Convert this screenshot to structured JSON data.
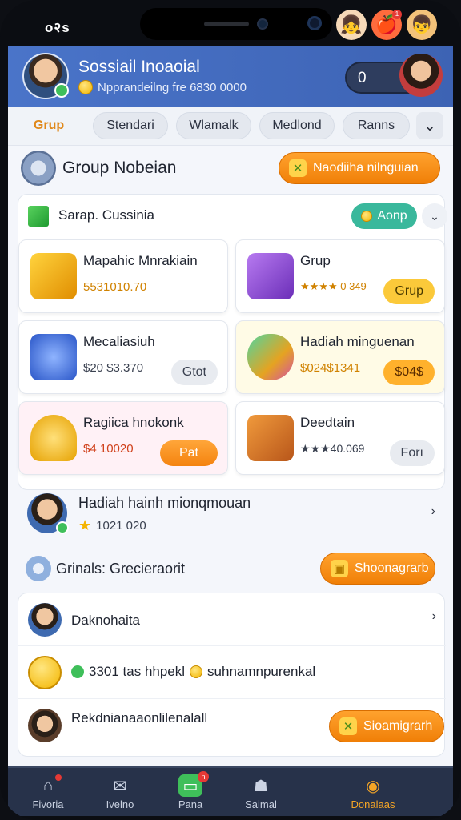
{
  "status": {
    "carrier": "o२s"
  },
  "header": {
    "title": "Sossiail Inoaoial",
    "subtitle": "Npprandeilng fre 6830 0000",
    "toggle_value": "0"
  },
  "tabs": [
    {
      "label": "Grup",
      "active": true
    },
    {
      "label": "Stendari",
      "active": false
    },
    {
      "label": "Wlamalk",
      "active": false
    },
    {
      "label": "Medlond",
      "active": false
    },
    {
      "label": "Ranns",
      "active": false
    }
  ],
  "group_section": {
    "title": "Group Nobeian",
    "action_label": "Naodiiha nilnguian"
  },
  "group_panel": {
    "title": "Sarap. Cussinia",
    "pill_label": "Aonp",
    "cards": [
      {
        "title": "Mapahic Mnrakiain",
        "price": "5531010.70",
        "button": null,
        "icon": "treasure-chest-icon",
        "tint": "#ffffff"
      },
      {
        "title": "Grup",
        "price": "★★★★ 0 349",
        "button": "Grup",
        "icon": "purple-chest-icon",
        "tint": "#ffffff"
      },
      {
        "title": "Mecaliasiuh",
        "price": "$20 $3.370",
        "button": "Gtot",
        "icon": "robot-toy-icon",
        "tint": "#ffffff"
      },
      {
        "title": "Hadiah minguenan",
        "price": "$024$1341",
        "button": "$04$",
        "icon": "gem-shield-icon",
        "tint": "#fffbe6"
      },
      {
        "title": "Ragiica hnokonk",
        "price": "$4 10020",
        "button": "Pat",
        "icon": "golden-vase-icon",
        "tint": "#fff1f6"
      },
      {
        "title": "Deedtain",
        "price": "★★★40.069",
        "button": "Forı",
        "icon": "wooden-box-icon",
        "tint": "#ffffff"
      }
    ]
  },
  "featured_person": {
    "name": "Hadiah hainh mionqmouan",
    "value": "1021 020"
  },
  "social_section": {
    "title": "Grinals: Grecieraorit",
    "action_label": "Shoonagrarb"
  },
  "list": [
    {
      "title": "Daknohaita",
      "extra": "",
      "has_chevron": true,
      "action": null
    },
    {
      "title": "3301 tas hhpekl",
      "extra": "suhnamnpurenkal",
      "has_chevron": false,
      "action": null
    },
    {
      "title": "Rekdnianaaonlilenalall",
      "extra": "",
      "has_chevron": false,
      "action": "Sioamigrarh"
    }
  ],
  "bottom_nav": [
    {
      "label": "Fivoria",
      "icon": "home-icon",
      "badge": "",
      "active": false
    },
    {
      "label": "Ivelno",
      "icon": "mail-icon",
      "badge": "",
      "active": false
    },
    {
      "label": "Pana",
      "icon": "chat-icon",
      "badge": "n",
      "active": false
    },
    {
      "label": "Saimal",
      "icon": "people-icon",
      "badge": "",
      "active": false
    },
    {
      "label": "Donalaas",
      "icon": "profile-icon",
      "badge": "",
      "active": true
    }
  ],
  "colors": {
    "header_blue": "#4a74c9",
    "accent_orange": "#f4830f",
    "nav_bg": "#27324a",
    "active_nav": "#f4a526"
  }
}
